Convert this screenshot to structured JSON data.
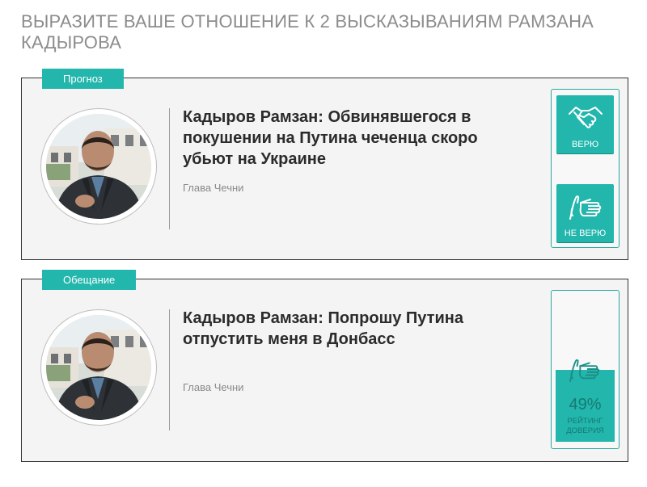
{
  "page": {
    "title": "ВЫРАЗИТЕ ВАШЕ ОТНОШЕНИЕ К 2 ВЫСКАЗЫВАНИЯМ РАМЗАНА КАДЫРОВА"
  },
  "statements": [
    {
      "tag": "Прогноз",
      "title": "Кадыров Рамзан: Обвинявшегося в покушении на Путина чеченца скоро убьют на Украине",
      "subtitle": "Глава Чечни",
      "believe_label": "ВЕРЮ",
      "disbelieve_label": "НЕ ВЕРЮ"
    },
    {
      "tag": "Обещание",
      "title": "Кадыров Рамзан: Попрошу Путина отпустить меня в Донбасс",
      "subtitle": "Глава Чечни",
      "rating_value": "49%",
      "rating_fraction": 0.49,
      "rating_label": "РЕЙТИНГ ДОВЕРИЯ"
    }
  ],
  "colors": {
    "accent": "#23b6ac",
    "card_bg": "#f3f4f3",
    "title_text": "#8c8c8c"
  },
  "icons": {
    "believe": "handshake-icon",
    "disbelieve": "hand-rejecting-icon"
  }
}
